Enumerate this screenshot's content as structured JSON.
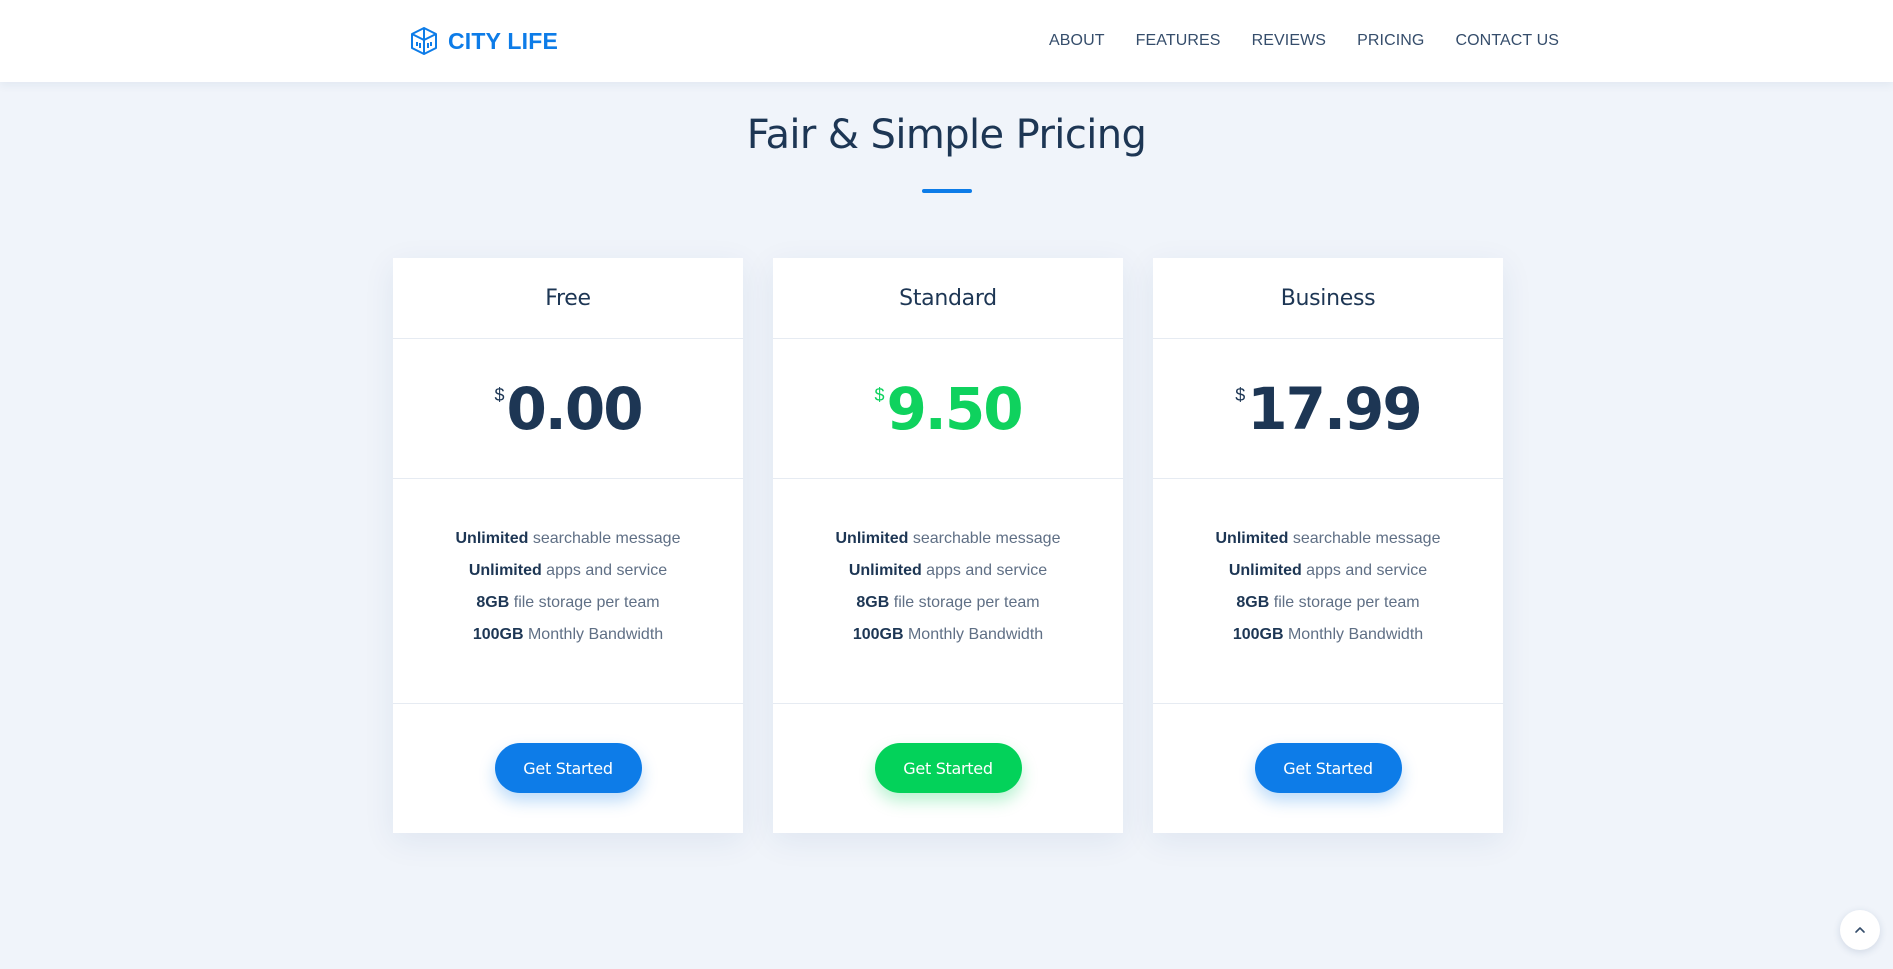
{
  "brand": {
    "name": "CITY LIFE",
    "icon": "building-cube-icon",
    "color": "#0d7ce8"
  },
  "nav": {
    "items": [
      {
        "label": "ABOUT"
      },
      {
        "label": "FEATURES"
      },
      {
        "label": "REVIEWS"
      },
      {
        "label": "PRICING"
      },
      {
        "label": "CONTACT US"
      }
    ]
  },
  "section": {
    "title": "Fair & Simple Pricing"
  },
  "plans": [
    {
      "name": "Free",
      "currency": "$",
      "amount": "0.00",
      "features": [
        {
          "strong": "Unlimited",
          "text": " searchable message"
        },
        {
          "strong": "Unlimited",
          "text": " apps and service"
        },
        {
          "strong": "8GB",
          "text": " file storage per team"
        },
        {
          "strong": "100GB",
          "text": " Monthly Bandwidth"
        }
      ],
      "cta": "Get Started",
      "accent": "#0d7ce8"
    },
    {
      "name": "Standard",
      "currency": "$",
      "amount": "9.50",
      "features": [
        {
          "strong": "Unlimited",
          "text": " searchable message"
        },
        {
          "strong": "Unlimited",
          "text": " apps and service"
        },
        {
          "strong": "8GB",
          "text": " file storage per team"
        },
        {
          "strong": "100GB",
          "text": " Monthly Bandwidth"
        }
      ],
      "cta": "Get Started",
      "accent": "#03d25a"
    },
    {
      "name": "Business",
      "currency": "$",
      "amount": "17.99",
      "features": [
        {
          "strong": "Unlimited",
          "text": " searchable message"
        },
        {
          "strong": "Unlimited",
          "text": " apps and service"
        },
        {
          "strong": "8GB",
          "text": " file storage per team"
        },
        {
          "strong": "100GB",
          "text": " Monthly Bandwidth"
        }
      ],
      "cta": "Get Started",
      "accent": "#0d7ce8"
    }
  ],
  "scroll_top": {
    "icon": "chevron-up-icon"
  }
}
